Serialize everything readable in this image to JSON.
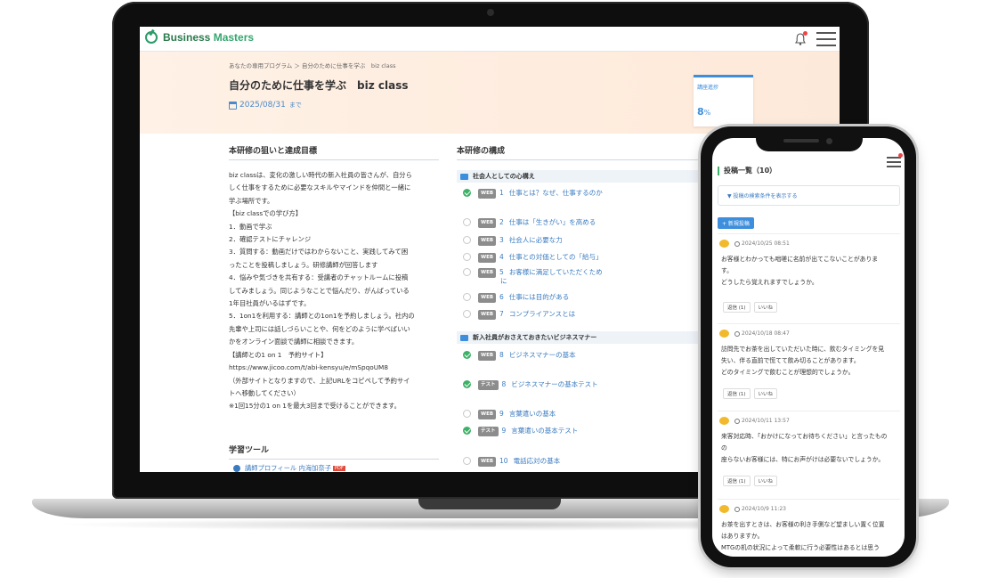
{
  "laptop": {
    "brand": {
      "part1": "Business ",
      "part2": "Masters"
    },
    "breadcrumb": "あなたの専用プログラム ＞ 自分のために仕事を学ぶ　biz class",
    "title": "自分のために仕事を学ぶ　biz class",
    "due_date": "2025/08/31",
    "due_suffix": "まで",
    "progress": {
      "label": "講座進捗",
      "value": "8",
      "unit": "%"
    },
    "goals_heading": "本研修の狙いと達成目標",
    "description": [
      "biz classは、変化の激しい時代の新入社員の皆さんが、自分ら",
      "しく仕事をするために必要なスキルやマインドを仲間と一緒に",
      "学ぶ場所です。",
      "",
      "【biz classでの学び方】",
      "1．動画で学ぶ",
      "2．確認テストにチャレンジ",
      "3．質問する：動画だけではわからないこと、実践してみて困",
      "ったことを投稿しましょう。研修講師が回答します",
      "4．悩みや気づきを共有する：受講者のチャットルームに投稿",
      "してみましょう。同じようなことで悩んだり、がんばっている",
      "1年目社員がいるはずです。",
      "5．1on1を利用する：講師との1on1を予約しましょう。社内の",
      "先輩や上司には話しづらいことや、何をどのように学べばいい",
      "かをオンライン面談で講師に相談できます。",
      "",
      "【講師との1 on 1　予約サイト】",
      "https://www.jicoo.com/t/abi-kensyu/e/mSpqoUM8",
      "（外部サイトとなりますので、上記URLをコピペして予約サイ",
      "トへ移動してください）",
      "※1回15分の1 on 1を最大3回まで受けることができます。"
    ],
    "tools_heading": "学習ツール",
    "tool_item": "講師プロフィール 内海加奈子",
    "tool_badge": "PDF",
    "structure_heading": "本研修の構成",
    "groups": [
      "社会人としての心構え",
      "新入社員がおさえておきたいビジネスマナー"
    ],
    "lessons": [
      {
        "tag": "WEB",
        "num": "1",
        "title": "仕事とは？なぜ、仕事するのか",
        "done": true
      },
      {
        "tag": "WEB",
        "num": "2",
        "title": "仕事は「生きがい」を高める",
        "done": false
      },
      {
        "tag": "WEB",
        "num": "3",
        "title": "社会人に必要な力",
        "done": false
      },
      {
        "tag": "WEB",
        "num": "4",
        "title": "仕事との対価としての「給与」",
        "done": false
      },
      {
        "tag": "WEB",
        "num": "5",
        "title": "お客様に満足していただくため",
        "title2": "に",
        "done": false
      },
      {
        "tag": "WEB",
        "num": "6",
        "title": "仕事には目的がある",
        "done": false
      },
      {
        "tag": "WEB",
        "num": "7",
        "title": "コンプライアンスとは",
        "done": false
      },
      {
        "tag": "WEB",
        "num": "8",
        "title": "ビジネスマナーの基本",
        "done": true
      },
      {
        "tag": "テスト",
        "num": "8",
        "title": "ビジネスマナーの基本テスト",
        "done": true
      },
      {
        "tag": "WEB",
        "num": "9",
        "title": "言葉遣いの基本",
        "done": false
      },
      {
        "tag": "テスト",
        "num": "9",
        "title": "言葉遣いの基本テスト",
        "done": true
      },
      {
        "tag": "WEB",
        "num": "10",
        "title": "電話応対の基本",
        "done": false
      }
    ]
  },
  "phone": {
    "title": "投稿一覧（10）",
    "search_toggle": "▼ 投稿の検索条件を表示する",
    "new_post": "+ 新規投稿",
    "posts": [
      {
        "date": "2024/10/25 08:51",
        "body": "お客様とわかっても咄嗟に名前が出てこないことがありま\nす。\nどうしたら覚えれますでしょうか。",
        "reply": "返信 (1)",
        "like": "いいね"
      },
      {
        "date": "2024/10/18 08:47",
        "body": "訪問先でお茶を出していただいた時に、飲むタイミングを見\n失い、伴る直前で慌てて飲み切ることがあります。\nどのタイミングで飲むことが理想的でしょうか。",
        "reply": "返信 (1)",
        "like": "いいね"
      },
      {
        "date": "2024/10/11 13:57",
        "body": "来客対応時、「おかけになってお待ちください」と言ったもの\nの\n座らないお客様には、特にお声がけは必要ないでしょうか。",
        "reply": "返信 (1)",
        "like": "いいね"
      },
      {
        "date": "2024/10/9 11:23",
        "body": "お茶を出すときは、お客様の利き手側など望ましい置く位置\nはありますか。\nMTGの机の状況によって柔軟に行う必要性はあるとは思う",
        "reply": "",
        "like": ""
      }
    ]
  }
}
